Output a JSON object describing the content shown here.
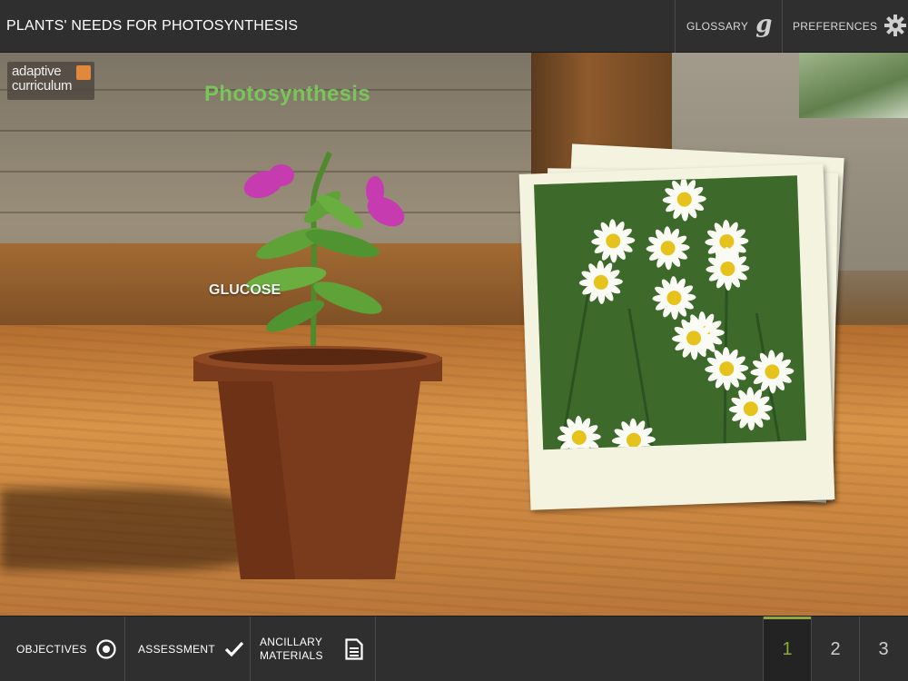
{
  "header": {
    "title": "PLANTS' NEEDS FOR PHOTOSYNTHESIS",
    "glossary_label": "GLOSSARY",
    "glossary_icon_letter": "g",
    "preferences_label": "PREFERENCES"
  },
  "scene": {
    "logo_line1": "adaptive",
    "logo_line2": "curriculum",
    "title": "Photosynthesis",
    "label": "GLUCOSE",
    "title_color": "#7ac55a"
  },
  "footer": {
    "objectives_label": "OBJECTIVES",
    "assessment_label": "ASSESSMENT",
    "ancillary_label_line1": "ANCILLARY",
    "ancillary_label_line2": "MATERIALS",
    "pages": [
      "1",
      "2",
      "3"
    ],
    "active_page": "1",
    "accent_color": "#8ea83c"
  },
  "icons": {
    "glossary": "glossary-g-icon",
    "preferences": "gear-icon",
    "objectives": "target-icon",
    "assessment": "checkmark-icon",
    "ancillary": "document-icon"
  }
}
